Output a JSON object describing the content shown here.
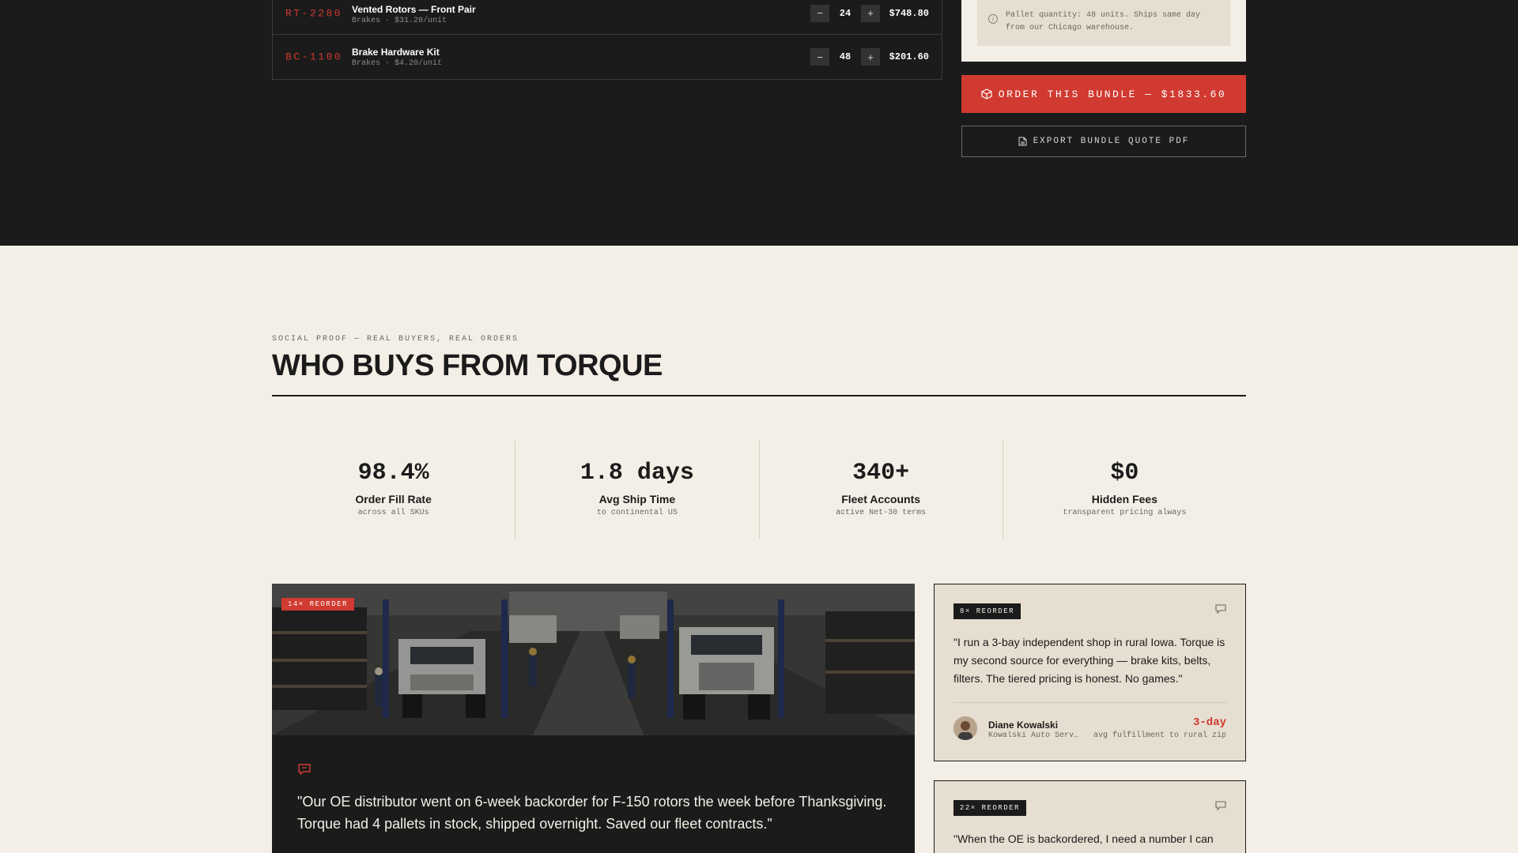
{
  "bundle": {
    "items": [
      {
        "sku": "RT-2280",
        "name": "Vented Rotors — Front Pair",
        "sub": "Brakes · $31.20/unit",
        "qty": "24",
        "total": "$748.80"
      },
      {
        "sku": "BC-1100",
        "name": "Brake Hardware Kit",
        "sub": "Brakes · $4.20/unit",
        "qty": "48",
        "total": "$201.60"
      }
    ],
    "stepper": {
      "minus": "−",
      "plus": "+"
    },
    "pallet_note": "Pallet quantity: 48 units. Ships same day from our Chicago warehouse.",
    "info_glyph": "i",
    "order_button": "ORDER THIS BUNDLE — $1833.60",
    "export_button": "EXPORT BUNDLE QUOTE PDF"
  },
  "social_proof": {
    "eyebrow": "SOCIAL PROOF — REAL BUYERS, REAL ORDERS",
    "title": "WHO BUYS FROM TORQUE",
    "stats": [
      {
        "value": "98.4%",
        "label": "Order Fill Rate",
        "sub": "across all SKUs"
      },
      {
        "value": "1.8 days",
        "label": "Avg Ship Time",
        "sub": "to continental US"
      },
      {
        "value": "340+",
        "label": "Fleet Accounts",
        "sub": "active Net-30 terms"
      },
      {
        "value": "$0",
        "label": "Hidden Fees",
        "sub": "transparent pricing always"
      }
    ],
    "featured": {
      "badge": "14× REORDER",
      "quote": "\"Our OE distributor went on 6-week backorder for F-150 rotors the week before Thanksgiving. Torque had 4 pallets in stock, shipped overnight. Saved our fleet contracts.\""
    },
    "testimonials": [
      {
        "badge": "8× REORDER",
        "quote": "\"I run a 3-bay independent shop in rural Iowa. Torque is my second source for everything — brake kits, belts, filters. The tiered pricing is honest. No games.\"",
        "author": "Diane Kowalski",
        "company": "Kowalski Auto Service",
        "metric": "3-day",
        "metric_sub": "avg fulfillment to rural zip"
      },
      {
        "badge": "22× REORDER",
        "quote": "\"When the OE is backordered, I need a number I can"
      }
    ]
  },
  "colors": {
    "accent": "#d03a30",
    "dark": "#1b1b1b",
    "cream": "#f3efe6",
    "card": "#e6ded0"
  },
  "icons": {
    "order": "box-icon",
    "export": "document-icon",
    "info": "info-icon",
    "quote": "chat-quote-icon"
  }
}
